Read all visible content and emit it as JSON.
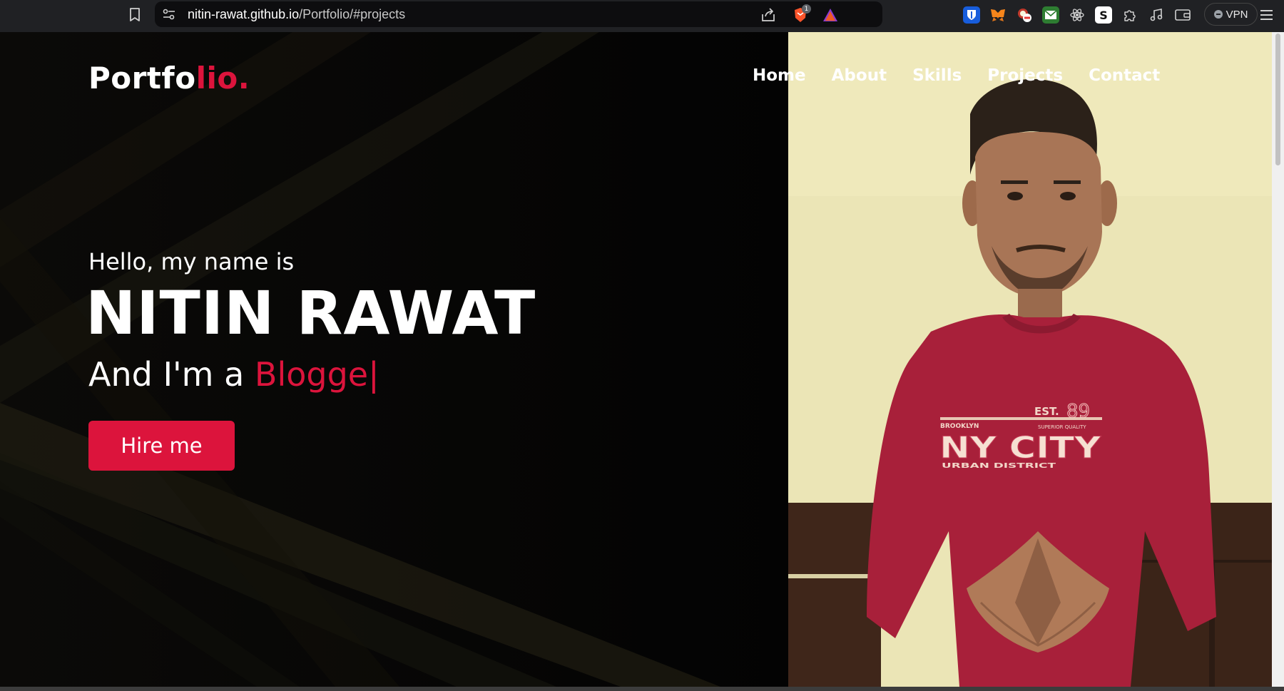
{
  "browser": {
    "url_host": "nitin-rawat.github.io",
    "url_path": "/Portfolio/#projects",
    "brave_shield_count": "1",
    "vpn_label": "VPN",
    "extensions": [
      "bitwarden-icon",
      "metamask-icon",
      "ublock-icon",
      "mail-icon",
      "react-devtools-icon",
      "s-extension-icon",
      "puzzle-icon",
      "music-icon",
      "wallet-icon"
    ]
  },
  "site": {
    "logo_main": "Portfo",
    "logo_accent": "lio.",
    "nav": [
      "Home",
      "About",
      "Skills",
      "Projects",
      "Contact"
    ],
    "hello": "Hello, my name is",
    "name": "NITIN RAWAT",
    "role_prefix": "And I'm a ",
    "role_typed": "Blogge",
    "caret": "|",
    "hire_label": "Hire me",
    "shirt_text": {
      "est": "EST.",
      "year": "89",
      "brooklyn": "BROOKLYN",
      "tagline": "SUPERIOR QUALITY",
      "big": "NY CITY",
      "district": "URBAN DISTRICT"
    }
  },
  "colors": {
    "accent": "#dc143c",
    "background": "#050505",
    "chrome": "#202124",
    "wall": "#ece6b6",
    "sweater": "#a8203a"
  }
}
